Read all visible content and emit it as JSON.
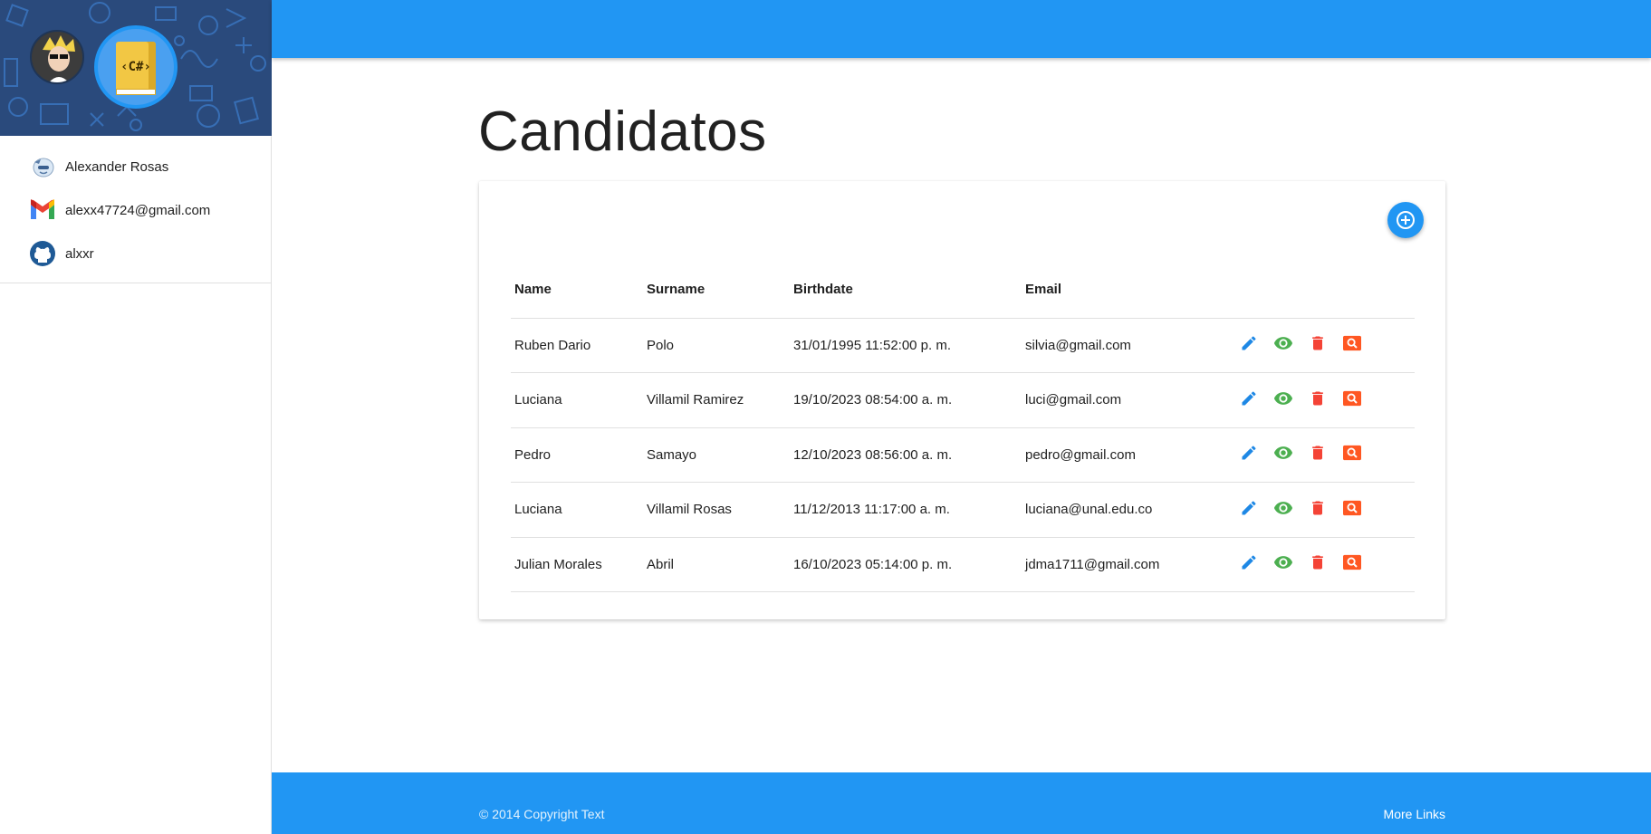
{
  "sidebar": {
    "items": [
      {
        "label": "Alexander Rosas",
        "icon": "user-avatar-icon"
      },
      {
        "label": "alexx47724@gmail.com",
        "icon": "gmail-icon"
      },
      {
        "label": "alxxr",
        "icon": "github-icon"
      }
    ],
    "logo_text": "‹C#›"
  },
  "main": {
    "title": "Candidatos",
    "add_icon": "add-circle-icon",
    "table": {
      "headers": [
        "Name",
        "Surname",
        "Birthdate",
        "Email"
      ],
      "rows": [
        {
          "name": "Ruben Dario",
          "surname": "Polo",
          "birthdate": "31/01/1995 11:52:00 p. m.",
          "email": "silvia@gmail.com"
        },
        {
          "name": "Luciana",
          "surname": "Villamil Ramirez",
          "birthdate": "19/10/2023 08:54:00 a. m.",
          "email": "luci@gmail.com"
        },
        {
          "name": "Pedro",
          "surname": "Samayo",
          "birthdate": "12/10/2023 08:56:00 a. m.",
          "email": "pedro@gmail.com"
        },
        {
          "name": "Luciana",
          "surname": "Villamil Rosas",
          "birthdate": "11/12/2013 11:17:00 a. m.",
          "email": "luciana@unal.edu.co"
        },
        {
          "name": "Julian Morales",
          "surname": "Abril",
          "birthdate": "16/10/2023 05:14:00 p. m.",
          "email": "jdma1711@gmail.com"
        }
      ],
      "action_icons": [
        "pencil-icon",
        "eye-icon",
        "trash-icon",
        "search-icon"
      ]
    }
  },
  "footer": {
    "copyright": "© 2014 Copyright Text",
    "links": "More Links"
  },
  "colors": {
    "primary": "#2196f3",
    "edit": "#1e88e5",
    "view": "#4caf50",
    "delete": "#f44336",
    "detail": "#ff5722"
  }
}
